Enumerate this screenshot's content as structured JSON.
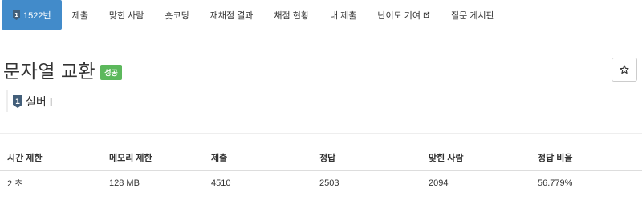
{
  "tabs": [
    {
      "label": "1522번",
      "active": true
    },
    {
      "label": "제출"
    },
    {
      "label": "맞힌 사람"
    },
    {
      "label": "숏코딩"
    },
    {
      "label": "재채점 결과"
    },
    {
      "label": "채점 현황"
    },
    {
      "label": "내 제출"
    },
    {
      "label": "난이도 기여"
    },
    {
      "label": "질문 게시판"
    }
  ],
  "problem": {
    "title": "문자열 교환",
    "result_badge": "성공",
    "tier_label": "실버 I",
    "star_icon": "☆"
  },
  "info_table": {
    "headers": [
      "시간 제한",
      "메모리 제한",
      "제출",
      "정답",
      "맞힌 사람",
      "정답 비율"
    ],
    "row": [
      "2 초",
      "128 MB",
      "4510",
      "2503",
      "2094",
      "56.779%"
    ]
  },
  "colors": {
    "active_tab": "#428bca",
    "success_badge": "#5cb85c",
    "silver_tier": "#435f7a"
  },
  "icons": {
    "tier": "silver-tier-badge-icon",
    "external": "external-link-icon",
    "star": "star-outline-icon"
  }
}
